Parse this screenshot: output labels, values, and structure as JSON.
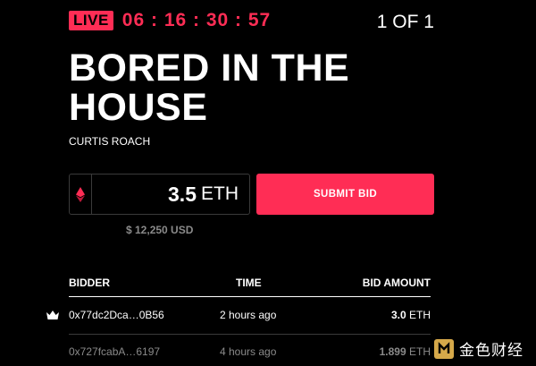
{
  "header": {
    "live_label": "LIVE",
    "countdown": "06 : 16 : 30 : 57",
    "counter": "1 OF 1"
  },
  "artwork": {
    "title": "BORED IN THE HOUSE",
    "artist": "CURTIS ROACH"
  },
  "bid": {
    "value": "3.5",
    "unit": "ETH",
    "usd": "$ 12,250 USD",
    "submit_label": "SUBMIT BID",
    "currency_icon": "ethereum-icon"
  },
  "table": {
    "headers": {
      "bidder": "BIDDER",
      "time": "TIME",
      "amount": "BID AMOUNT"
    },
    "rows": [
      {
        "leader_icon": "crown-icon",
        "bidder": "0x77dc2Dca…0B56",
        "time": "2 hours ago",
        "amount": "3.0",
        "unit": "ETH"
      },
      {
        "bidder": "0x727fcabA…6197",
        "time": "4 hours ago",
        "amount": "1.899",
        "unit": "ETH"
      }
    ]
  },
  "watermark": {
    "text": "金色财经",
    "icon": "jinse-logo-icon"
  },
  "colors": {
    "accent": "#ff2d55",
    "background": "#000000",
    "muted_text": "#8a8a8a",
    "border": "#3a3a3a"
  }
}
